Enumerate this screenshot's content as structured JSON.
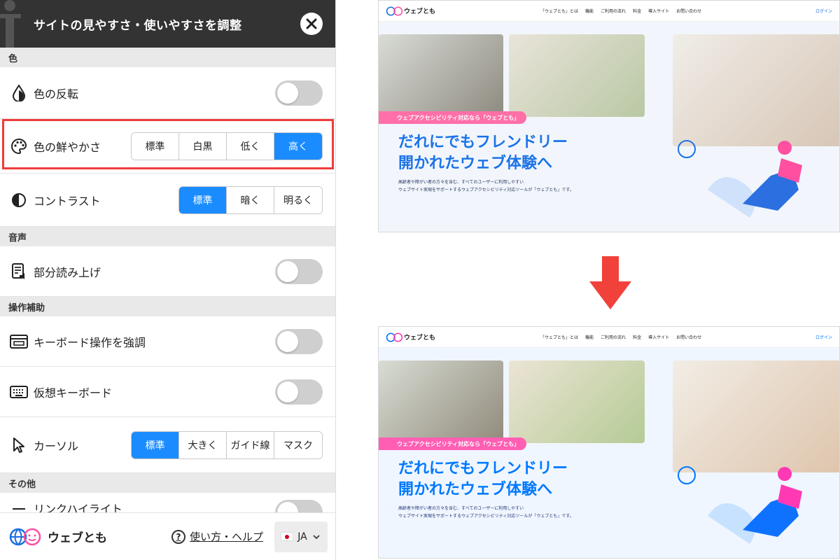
{
  "panel": {
    "title": "サイトの見やすさ・使いやすさを調整",
    "sections": {
      "color": "色",
      "audio": "音声",
      "assist": "操作補助",
      "other": "その他"
    },
    "rows": {
      "invert": "色の反転",
      "saturation": "色の鮮やかさ",
      "contrast": "コントラスト",
      "read_aloud": "部分読み上げ",
      "keyboard_focus": "キーボード操作を強調",
      "virtual_keyboard": "仮想キーボード",
      "cursor": "カーソル",
      "partial_hidden": "リンクハイライト"
    },
    "saturation_options": [
      "標準",
      "白黒",
      "低く",
      "高く"
    ],
    "saturation_selected": "高く",
    "contrast_options": [
      "標準",
      "暗く",
      "明るく"
    ],
    "contrast_selected": "標準",
    "cursor_options": [
      "標準",
      "大きく",
      "ガイド線",
      "マスク"
    ],
    "cursor_selected": "標準",
    "footer": {
      "brand": "ウェブとも",
      "help": "使い方・ヘルプ",
      "lang": "JA"
    }
  },
  "preview": {
    "logo": "ウェブとも",
    "menu": [
      "「ウェブとも」とは",
      "機能",
      "ご利用の流れ",
      "料金",
      "導入サイト",
      "お問い合わせ"
    ],
    "login": "ログイン",
    "tag": "ウェブアクセシビリティ対応なら「ウェブとも」",
    "headline_1": "だれにでもフレンドリー",
    "headline_2": "開かれたウェブ体験へ",
    "sub_1": "高齢者や障がい者の方々を含む、すべてのユーザーに利用しやすい",
    "sub_2": "ウェブサイト実現をサポートするウェブアクセシビリティ対応ツールが「ウェブとも」です。"
  },
  "colors": {
    "accent": "#1a8cff",
    "header": "#333333",
    "highlight": "#ef3c3c",
    "arrow": "#f0413b",
    "pink": "#ff6fa8",
    "headline": "#1b73e8"
  }
}
